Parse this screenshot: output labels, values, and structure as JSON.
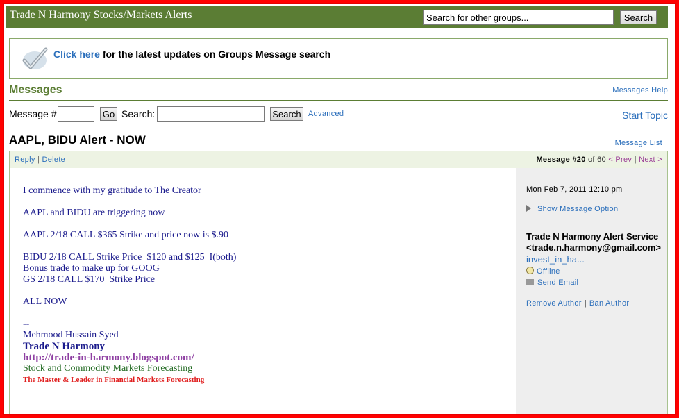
{
  "header": {
    "group_title": "Trade N Harmony Stocks/Markets Alerts",
    "search_placeholder": "Search for other groups...",
    "search_button": "Search"
  },
  "announcement": {
    "link_text": "Click here",
    "text": " for the latest updates on Groups Message search"
  },
  "messages": {
    "title": "Messages",
    "help_link": "Messages Help"
  },
  "search_bar": {
    "message_num_label": "Message #",
    "message_num_value": "",
    "go_button": "Go",
    "search_label": "Search:",
    "search_value": "",
    "search_button": "Search",
    "advanced_link": "Advanced",
    "start_topic": "Start Topic"
  },
  "topic": {
    "title": "AAPL, BIDU Alert - NOW",
    "message_list_link": "Message List"
  },
  "message": {
    "reply": "Reply",
    "delete": "Delete",
    "number_label": "Message #20",
    "of_total": " of 60 ",
    "prev": "< Prev",
    "next": "Next >",
    "body": [
      "I commence with my gratitude to The Creator",
      "",
      "AAPL and BIDU are triggering now",
      "",
      "AAPL 2/18 CALL $365 Strike and price now is $.90",
      "",
      "BIDU 2/18 CALL Strike Price  $120 and $125  I(both)",
      "Bonus trade to make up for GOOG",
      "GS 2/18 CALL $170  Strike Price",
      "",
      "ALL NOW",
      "",
      "--",
      "Mehmood Hussain Syed"
    ],
    "signature": {
      "name": "Trade N Harmony",
      "url": "http://trade-in-harmony.blogspot.com/",
      "tagline": "Stock and Commodity Markets Forecasting",
      "motto": "The Master & Leader in Financial Markets Forecasting"
    }
  },
  "sidebar": {
    "date": "Mon Feb 7, 2011 12:10 pm",
    "show_option": "Show Message Option",
    "author_name": "Trade N Harmony Alert Service",
    "author_email": "<trade.n.harmony@gmail.com>",
    "yahoo_id": "invest_in_ha...",
    "status": "Offline",
    "send_email": "Send Email",
    "remove_author": "Remove Author",
    "ban_author": "Ban Author"
  },
  "colors": {
    "header_green": "#5b7d34",
    "link_blue": "#2a6ebb",
    "frame_red": "#ff0000"
  }
}
